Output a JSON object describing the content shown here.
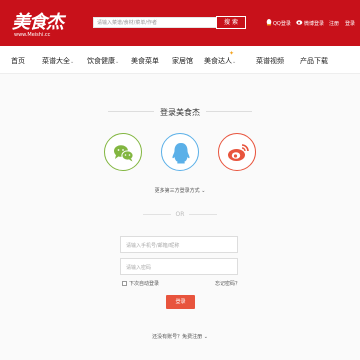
{
  "header": {
    "logo_text": "美食杰",
    "logo_url": "www.Meishi.cc",
    "search_placeholder": "请输入菜谱/食材/菜单/作者",
    "search_button": "搜 索",
    "qq_login": "QQ登录",
    "weibo_login": "微博登录",
    "register": "注册",
    "login": "登录"
  },
  "nav": {
    "items": [
      {
        "label": "首页"
      },
      {
        "label": "菜谱大全"
      },
      {
        "label": "饮食健康"
      },
      {
        "label": "美食菜单"
      },
      {
        "label": "家居馆"
      },
      {
        "label": "美食达人"
      },
      {
        "label": "菜谱视频"
      },
      {
        "label": "产品下载"
      }
    ],
    "dropdown_glyph": "⌄"
  },
  "login": {
    "title": "登录美食杰",
    "more_methods": "更多第三方登录方式 ⌄",
    "or": "OR",
    "account_placeholder": "请输入手机号/邮箱/昵称",
    "password_placeholder": "请输入密码",
    "remember": "下次自动登录",
    "forgot": "忘记密码？",
    "submit": "登录",
    "no_account": "还没有账号？免费注册 ⌄"
  },
  "colors": {
    "brand_red": "#c8111a",
    "wechat_green": "#82b640",
    "qq_blue": "#5bb0e8",
    "weibo_red": "#e8543d",
    "submit_button": "#e8543d"
  }
}
